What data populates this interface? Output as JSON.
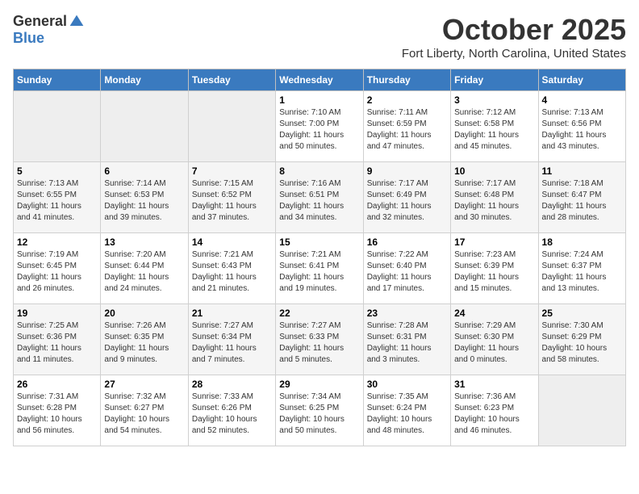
{
  "logo": {
    "general": "General",
    "blue": "Blue"
  },
  "header": {
    "month": "October 2025",
    "location": "Fort Liberty, North Carolina, United States"
  },
  "days_of_week": [
    "Sunday",
    "Monday",
    "Tuesday",
    "Wednesday",
    "Thursday",
    "Friday",
    "Saturday"
  ],
  "weeks": [
    [
      {
        "day": "",
        "info": ""
      },
      {
        "day": "",
        "info": ""
      },
      {
        "day": "",
        "info": ""
      },
      {
        "day": "1",
        "info": "Sunrise: 7:10 AM\nSunset: 7:00 PM\nDaylight: 11 hours\nand 50 minutes."
      },
      {
        "day": "2",
        "info": "Sunrise: 7:11 AM\nSunset: 6:59 PM\nDaylight: 11 hours\nand 47 minutes."
      },
      {
        "day": "3",
        "info": "Sunrise: 7:12 AM\nSunset: 6:58 PM\nDaylight: 11 hours\nand 45 minutes."
      },
      {
        "day": "4",
        "info": "Sunrise: 7:13 AM\nSunset: 6:56 PM\nDaylight: 11 hours\nand 43 minutes."
      }
    ],
    [
      {
        "day": "5",
        "info": "Sunrise: 7:13 AM\nSunset: 6:55 PM\nDaylight: 11 hours\nand 41 minutes."
      },
      {
        "day": "6",
        "info": "Sunrise: 7:14 AM\nSunset: 6:53 PM\nDaylight: 11 hours\nand 39 minutes."
      },
      {
        "day": "7",
        "info": "Sunrise: 7:15 AM\nSunset: 6:52 PM\nDaylight: 11 hours\nand 37 minutes."
      },
      {
        "day": "8",
        "info": "Sunrise: 7:16 AM\nSunset: 6:51 PM\nDaylight: 11 hours\nand 34 minutes."
      },
      {
        "day": "9",
        "info": "Sunrise: 7:17 AM\nSunset: 6:49 PM\nDaylight: 11 hours\nand 32 minutes."
      },
      {
        "day": "10",
        "info": "Sunrise: 7:17 AM\nSunset: 6:48 PM\nDaylight: 11 hours\nand 30 minutes."
      },
      {
        "day": "11",
        "info": "Sunrise: 7:18 AM\nSunset: 6:47 PM\nDaylight: 11 hours\nand 28 minutes."
      }
    ],
    [
      {
        "day": "12",
        "info": "Sunrise: 7:19 AM\nSunset: 6:45 PM\nDaylight: 11 hours\nand 26 minutes."
      },
      {
        "day": "13",
        "info": "Sunrise: 7:20 AM\nSunset: 6:44 PM\nDaylight: 11 hours\nand 24 minutes."
      },
      {
        "day": "14",
        "info": "Sunrise: 7:21 AM\nSunset: 6:43 PM\nDaylight: 11 hours\nand 21 minutes."
      },
      {
        "day": "15",
        "info": "Sunrise: 7:21 AM\nSunset: 6:41 PM\nDaylight: 11 hours\nand 19 minutes."
      },
      {
        "day": "16",
        "info": "Sunrise: 7:22 AM\nSunset: 6:40 PM\nDaylight: 11 hours\nand 17 minutes."
      },
      {
        "day": "17",
        "info": "Sunrise: 7:23 AM\nSunset: 6:39 PM\nDaylight: 11 hours\nand 15 minutes."
      },
      {
        "day": "18",
        "info": "Sunrise: 7:24 AM\nSunset: 6:37 PM\nDaylight: 11 hours\nand 13 minutes."
      }
    ],
    [
      {
        "day": "19",
        "info": "Sunrise: 7:25 AM\nSunset: 6:36 PM\nDaylight: 11 hours\nand 11 minutes."
      },
      {
        "day": "20",
        "info": "Sunrise: 7:26 AM\nSunset: 6:35 PM\nDaylight: 11 hours\nand 9 minutes."
      },
      {
        "day": "21",
        "info": "Sunrise: 7:27 AM\nSunset: 6:34 PM\nDaylight: 11 hours\nand 7 minutes."
      },
      {
        "day": "22",
        "info": "Sunrise: 7:27 AM\nSunset: 6:33 PM\nDaylight: 11 hours\nand 5 minutes."
      },
      {
        "day": "23",
        "info": "Sunrise: 7:28 AM\nSunset: 6:31 PM\nDaylight: 11 hours\nand 3 minutes."
      },
      {
        "day": "24",
        "info": "Sunrise: 7:29 AM\nSunset: 6:30 PM\nDaylight: 11 hours\nand 0 minutes."
      },
      {
        "day": "25",
        "info": "Sunrise: 7:30 AM\nSunset: 6:29 PM\nDaylight: 10 hours\nand 58 minutes."
      }
    ],
    [
      {
        "day": "26",
        "info": "Sunrise: 7:31 AM\nSunset: 6:28 PM\nDaylight: 10 hours\nand 56 minutes."
      },
      {
        "day": "27",
        "info": "Sunrise: 7:32 AM\nSunset: 6:27 PM\nDaylight: 10 hours\nand 54 minutes."
      },
      {
        "day": "28",
        "info": "Sunrise: 7:33 AM\nSunset: 6:26 PM\nDaylight: 10 hours\nand 52 minutes."
      },
      {
        "day": "29",
        "info": "Sunrise: 7:34 AM\nSunset: 6:25 PM\nDaylight: 10 hours\nand 50 minutes."
      },
      {
        "day": "30",
        "info": "Sunrise: 7:35 AM\nSunset: 6:24 PM\nDaylight: 10 hours\nand 48 minutes."
      },
      {
        "day": "31",
        "info": "Sunrise: 7:36 AM\nSunset: 6:23 PM\nDaylight: 10 hours\nand 46 minutes."
      },
      {
        "day": "",
        "info": ""
      }
    ]
  ]
}
